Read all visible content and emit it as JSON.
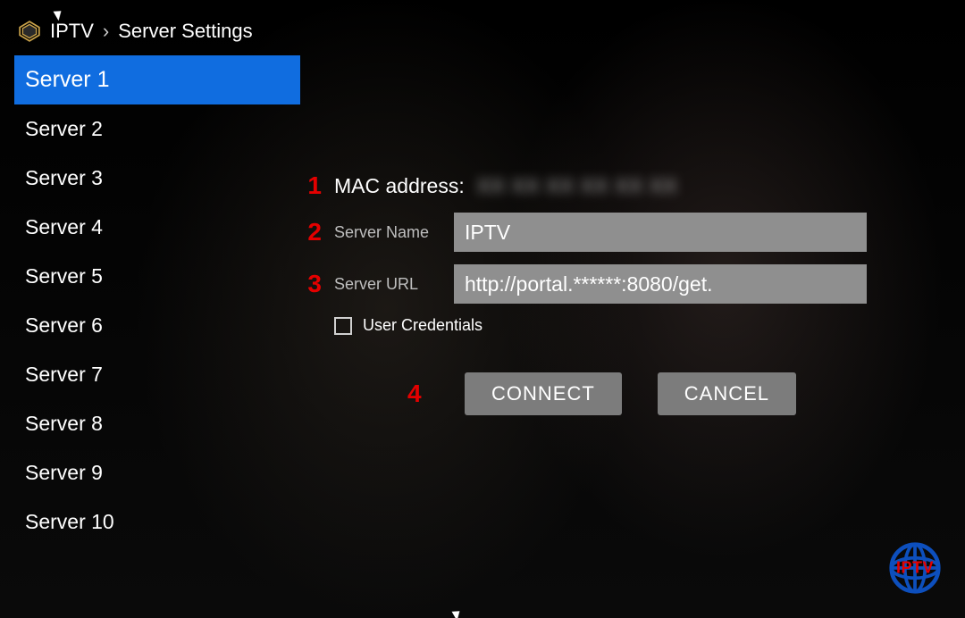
{
  "breadcrumb": {
    "app": "IPTV",
    "page": "Server Settings"
  },
  "sidebar": {
    "items": [
      {
        "label": "Server 1",
        "active": true
      },
      {
        "label": "Server 2",
        "active": false
      },
      {
        "label": "Server 3",
        "active": false
      },
      {
        "label": "Server 4",
        "active": false
      },
      {
        "label": "Server 5",
        "active": false
      },
      {
        "label": "Server 6",
        "active": false
      },
      {
        "label": "Server 7",
        "active": false
      },
      {
        "label": "Server 8",
        "active": false
      },
      {
        "label": "Server 9",
        "active": false
      },
      {
        "label": "Server 10",
        "active": false
      }
    ]
  },
  "form": {
    "mac_label": "MAC address:",
    "mac_value": "XX XX XX XX XX XX",
    "server_name_label": "Server Name",
    "server_name_value": "IPTV",
    "server_url_label": "Server URL",
    "server_url_value": "http://portal.******:8080/get.",
    "user_credentials_label": "User Credentials",
    "user_credentials_checked": false
  },
  "annotations": {
    "n1": "1",
    "n2": "2",
    "n3": "3",
    "n4": "4"
  },
  "buttons": {
    "connect": "CONNECT",
    "cancel": "CANCEL"
  },
  "watermark": {
    "text": "IPTV"
  },
  "colors": {
    "accent_blue": "#106de0",
    "annotation_red": "#e40000",
    "field_bg": "#8f8f8f",
    "button_bg": "#7c7c7c"
  }
}
